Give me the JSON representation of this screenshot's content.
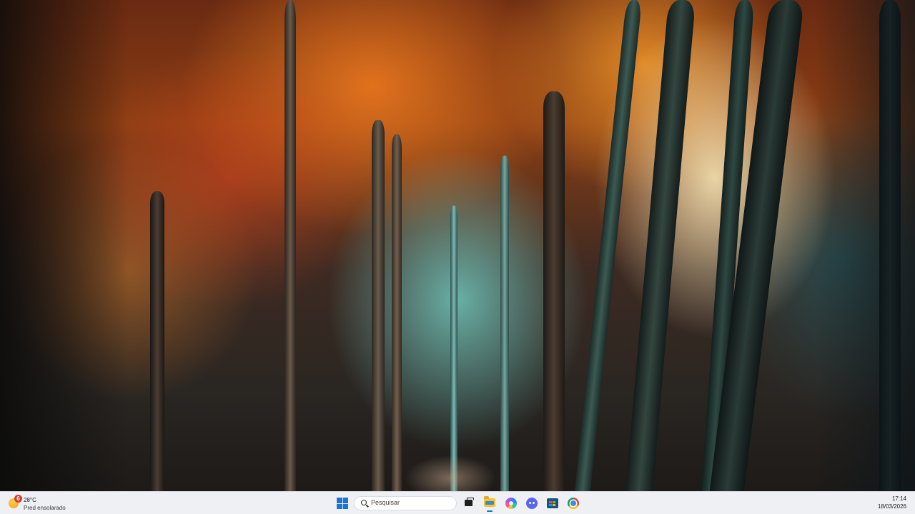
{
  "taskbar": {
    "weather": {
      "badge": "6",
      "temperature": "28°C",
      "condition": "Pred ensolarado",
      "icon": "sun-icon"
    },
    "search": {
      "placeholder": "Pesquisar"
    },
    "apps": [
      {
        "name": "Start",
        "icon": "windows-logo-icon"
      },
      {
        "name": "Task View",
        "icon": "task-view-icon"
      },
      {
        "name": "File Explorer",
        "icon": "folder-icon",
        "active": true
      },
      {
        "name": "Copilot",
        "icon": "copilot-icon"
      },
      {
        "name": "Discord",
        "icon": "discord-icon"
      },
      {
        "name": "Microsoft Store",
        "icon": "store-icon"
      },
      {
        "name": "Google Chrome",
        "icon": "chrome-icon"
      }
    ],
    "clock": {
      "time": "17:14",
      "date": "18/03/2026"
    }
  },
  "colors": {
    "taskbar_bg": "#eef0f3",
    "accent": "#1a74d2",
    "badge": "#d63b2f"
  }
}
